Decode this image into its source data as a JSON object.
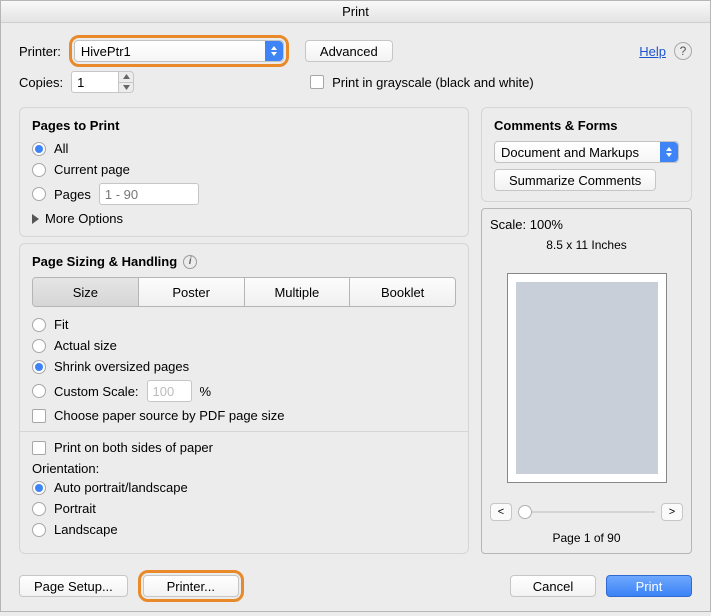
{
  "title": "Print",
  "top": {
    "printer_label": "Printer:",
    "printer_value": "HivePtr1",
    "advanced": "Advanced",
    "help": "Help",
    "copies_label": "Copies:",
    "copies_value": "1",
    "grayscale": "Print in grayscale (black and white)"
  },
  "pages": {
    "title": "Pages to Print",
    "all": "All",
    "current": "Current page",
    "pages": "Pages",
    "pages_placeholder": "1 - 90",
    "more": "More Options"
  },
  "sizing": {
    "title": "Page Sizing & Handling",
    "seg": {
      "size": "Size",
      "poster": "Poster",
      "multiple": "Multiple",
      "booklet": "Booklet"
    },
    "fit": "Fit",
    "actual": "Actual size",
    "shrink": "Shrink oversized pages",
    "custom_scale": "Custom Scale:",
    "custom_scale_value": "100",
    "percent": "%",
    "paper_source": "Choose paper source by PDF page size",
    "duplex": "Print on both sides of paper",
    "orientation_label": "Orientation:",
    "auto": "Auto portrait/landscape",
    "portrait": "Portrait",
    "landscape": "Landscape"
  },
  "comments": {
    "title": "Comments & Forms",
    "dropdown": "Document and Markups",
    "summarize": "Summarize Comments"
  },
  "preview": {
    "scale": "Scale: 100%",
    "paper_size": "8.5 x 11 Inches",
    "page_nav": "Page 1 of 90",
    "prev": "<",
    "next": ">"
  },
  "buttons": {
    "page_setup": "Page Setup...",
    "printer": "Printer...",
    "cancel": "Cancel",
    "print": "Print"
  }
}
